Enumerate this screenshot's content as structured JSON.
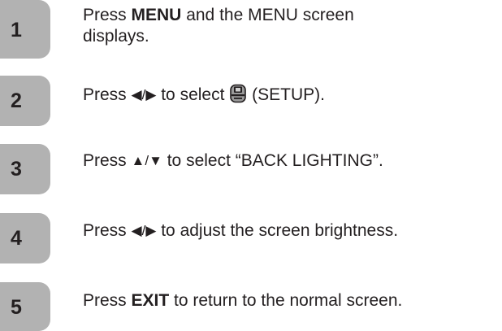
{
  "steps": [
    {
      "number": "1",
      "parts": [
        {
          "text": "Press ",
          "bold": false
        },
        {
          "text": "MENU",
          "bold": true
        },
        {
          "text": " and the MENU screen",
          "bold": false
        }
      ],
      "line2": "displays."
    },
    {
      "number": "2",
      "pre": "Press ",
      "arrows": "◀/▶",
      "mid": " to select ",
      "icon": "setup-icon",
      "post": " (SETUP)."
    },
    {
      "number": "3",
      "pre": "Press ",
      "arrows": "▲/▼",
      "post": " to select “BACK LIGHTING”."
    },
    {
      "number": "4",
      "pre": "Press ",
      "arrows": "◀/▶",
      "post": " to adjust the screen brightness."
    },
    {
      "number": "5",
      "pre": "Press ",
      "bold": "EXIT",
      "post": " to return to the normal screen."
    }
  ],
  "colors": {
    "tab": "#b2b2b2",
    "text": "#231f20"
  }
}
